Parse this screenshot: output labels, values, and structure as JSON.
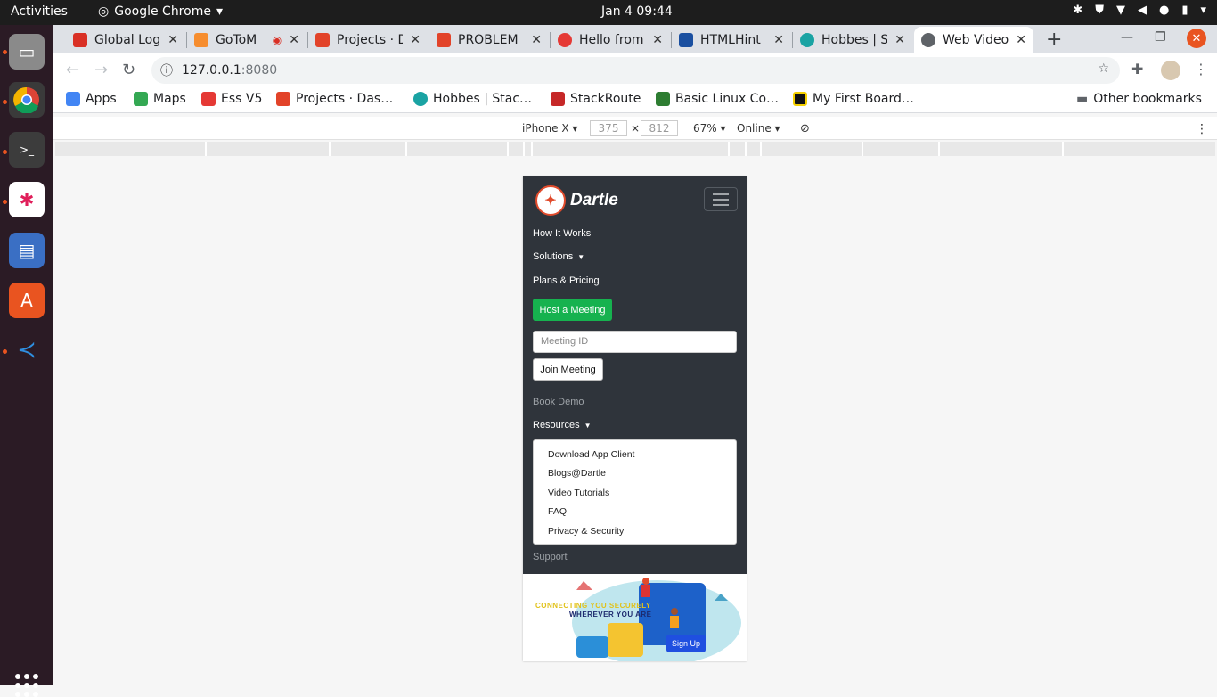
{
  "os": {
    "activities": "Activities",
    "app_name": "Google Chrome",
    "clock": "Jan 4  09:44"
  },
  "browser": {
    "tabs": [
      {
        "label": "Global Log",
        "icon": "gmail-icon",
        "color": "#d93025"
      },
      {
        "label": "GoToM",
        "icon": "gotomeeting-icon",
        "color": "#f68d2e"
      },
      {
        "label": "Projects · D",
        "icon": "gitlab-icon",
        "color": "#e24329"
      },
      {
        "label": "PROBLEM",
        "icon": "gitlab-icon",
        "color": "#e24329"
      },
      {
        "label": "Hello from",
        "icon": "app-icon",
        "color": "#e53935"
      },
      {
        "label": "HTMLHint",
        "icon": "htmlhint-icon",
        "color": "#1a4fa0"
      },
      {
        "label": "Hobbes | S",
        "icon": "hobbes-icon",
        "color": "#1aa3a3"
      },
      {
        "label": "Web Video",
        "icon": "globe-icon",
        "color": "#5f6368"
      }
    ],
    "url_host": "127.0.0.1",
    "url_port": ":8080",
    "bookmarks": [
      {
        "label": "Apps",
        "color": "#4285f4"
      },
      {
        "label": "Maps",
        "color": "#34a853"
      },
      {
        "label": "Ess V5",
        "color": "#e53935"
      },
      {
        "label": "Projects · Das…",
        "color": "#e24329"
      },
      {
        "label": "Hobbes | Stac…",
        "color": "#1aa3a3"
      },
      {
        "label": "StackRoute",
        "color": "#c62828"
      },
      {
        "label": "Basic Linux Co…",
        "color": "#2e7d32"
      },
      {
        "label": "My First Board…",
        "color": "#111111"
      }
    ],
    "other_bookmarks": "Other bookmarks"
  },
  "devtools": {
    "device": "iPhone X",
    "width": "375",
    "times": "×",
    "height": "812",
    "zoom": "67%",
    "network": "Online"
  },
  "page": {
    "brand": "Dartle",
    "nav": {
      "how_it_works": "How It Works",
      "solutions": "Solutions",
      "plans": "Plans & Pricing",
      "host_meeting": "Host a Meeting",
      "meeting_id_placeholder": "Meeting ID",
      "join_meeting": "Join Meeting",
      "book_demo": "Book Demo",
      "resources": "Resources",
      "support": "Support"
    },
    "resources_menu": [
      "Download App Client",
      "Blogs@Dartle",
      "Video Tutorials",
      "FAQ",
      "Privacy & Security"
    ],
    "hero": {
      "line1": "CONNECTING YOU SECURELY",
      "line2": "WHEREVER YOU ARE",
      "signup": "Sign Up"
    }
  },
  "colors": {
    "navbar_bg": "#2f343b",
    "host_button": "#16b24f",
    "signup_button": "#1f4fe0",
    "ubuntu_accent": "#e95420"
  }
}
